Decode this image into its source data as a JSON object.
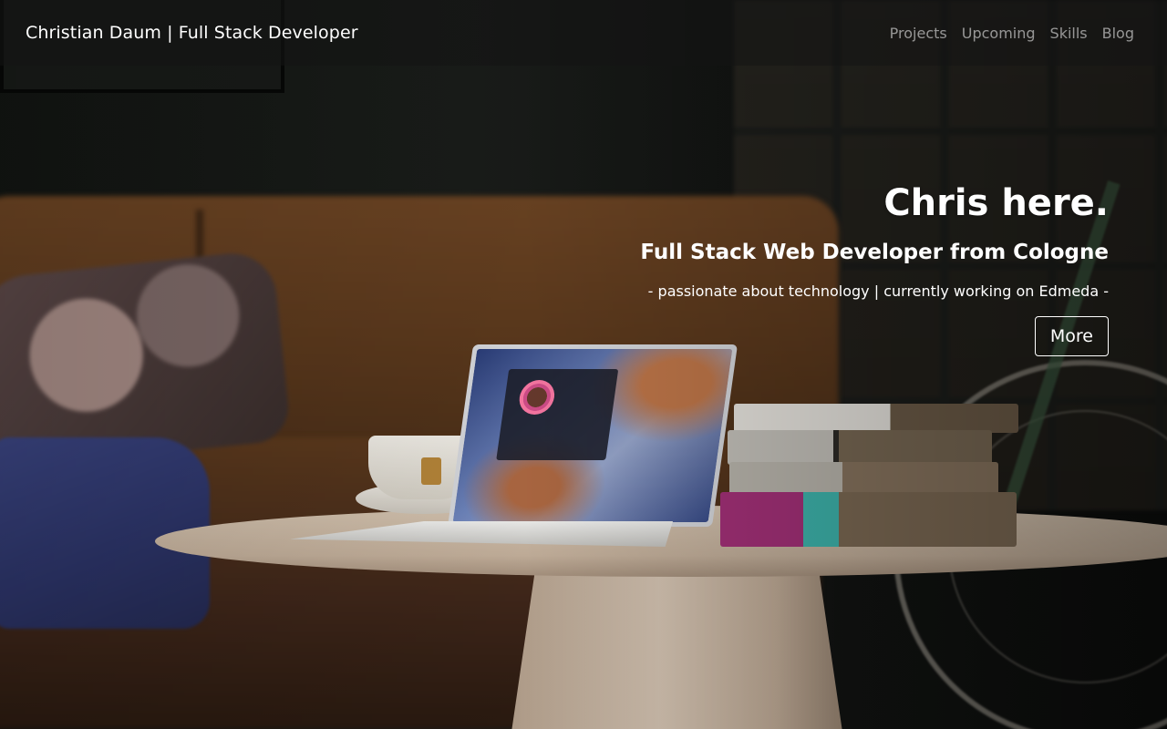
{
  "nav": {
    "brand": "Christian Daum | Full Stack Developer",
    "links": [
      {
        "label": "Projects"
      },
      {
        "label": "Upcoming"
      },
      {
        "label": "Skills"
      },
      {
        "label": "Blog"
      }
    ]
  },
  "hero": {
    "title": "Chris here.",
    "subtitle": "Full Stack Web Developer from Cologne",
    "tagline": "- passionate about technology | currently working on Edmeda -",
    "button_label": "More"
  },
  "colors": {
    "navbar_bg": "#141414",
    "text": "#ffffff",
    "nav_link": "#9b9b9b"
  }
}
